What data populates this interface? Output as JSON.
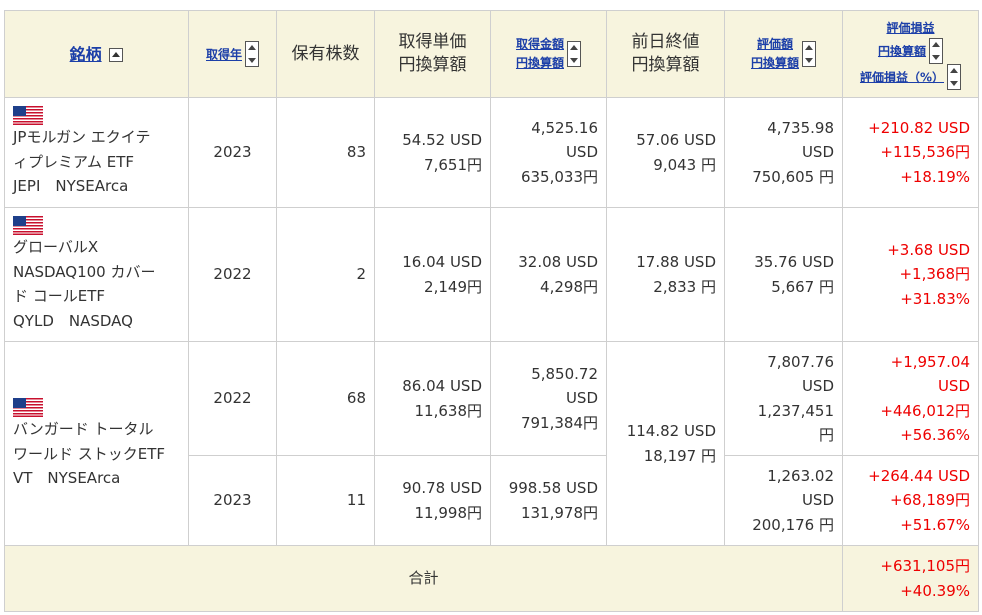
{
  "header": {
    "name": "銘柄",
    "year": "取得年",
    "shares": "保有株数",
    "unit_price_1": "取得単価",
    "unit_price_2": "円換算額",
    "acq_amount_1": "取得金額",
    "acq_amount_2": "円換算額",
    "prev_close_1": "前日終値",
    "prev_close_2": "円換算額",
    "valuation_1": "評価額",
    "valuation_2": "円換算額",
    "pnl_1": "評価損益",
    "pnl_2": "円換算額",
    "pnl_3": "評価損益（%）"
  },
  "rows": [
    {
      "name_line1": "JPモルガン エクイテ",
      "name_line2": "ィプレミアム ETF",
      "name_line3": "JEPI　NYSEArca",
      "year": "2023",
      "shares": "83",
      "unit_usd": "54.52 USD",
      "unit_jpy": "7,651円",
      "acq_usd_1": "4,525.16",
      "acq_usd_2": "USD",
      "acq_jpy": "635,033円",
      "prev_usd": "57.06 USD",
      "prev_jpy": "9,043 円",
      "val_usd_1": "4,735.98",
      "val_usd_2": "USD",
      "val_jpy": "750,605 円",
      "pnl_usd": "+210.82 USD",
      "pnl_jpy": "+115,536円",
      "pnl_pct": "+18.19%"
    },
    {
      "name_line1": "グローバルX",
      "name_line2": "NASDAQ100 カバー",
      "name_line3": "ド コールETF",
      "name_line4": "QYLD　NASDAQ",
      "year": "2022",
      "shares": "2",
      "unit_usd": "16.04 USD",
      "unit_jpy": "2,149円",
      "acq_usd": "32.08 USD",
      "acq_jpy": "4,298円",
      "prev_usd": "17.88 USD",
      "prev_jpy": "2,833 円",
      "val_usd": "35.76 USD",
      "val_jpy": "5,667 円",
      "pnl_usd": "+3.68 USD",
      "pnl_jpy": "+1,368円",
      "pnl_pct": "+31.83%"
    },
    {
      "name_line1": "バンガード トータル",
      "name_line2": "ワールド ストックETF",
      "name_line3": "VT　NYSEArca",
      "prev_usd": "114.82 USD",
      "prev_jpy": "18,197 円",
      "lots": [
        {
          "year": "2022",
          "shares": "68",
          "unit_usd": "86.04 USD",
          "unit_jpy": "11,638円",
          "acq_usd_1": "5,850.72",
          "acq_usd_2": "USD",
          "acq_jpy": "791,384円",
          "val_usd_1": "7,807.76",
          "val_usd_2": "USD",
          "val_jpy_1": "1,237,451",
          "val_jpy_2": "円",
          "pnl_usd_1": "+1,957.04",
          "pnl_usd_2": "USD",
          "pnl_jpy": "+446,012円",
          "pnl_pct": "+56.36%"
        },
        {
          "year": "2023",
          "shares": "11",
          "unit_usd": "90.78 USD",
          "unit_jpy": "11,998円",
          "acq_usd": "998.58 USD",
          "acq_jpy": "131,978円",
          "val_usd_1": "1,263.02",
          "val_usd_2": "USD",
          "val_jpy": "200,176 円",
          "pnl_usd": "+264.44 USD",
          "pnl_jpy": "+68,189円",
          "pnl_pct": "+51.67%"
        }
      ]
    }
  ],
  "total": {
    "label": "合計",
    "pnl_jpy": "+631,105円",
    "pnl_pct": "+40.39%"
  }
}
